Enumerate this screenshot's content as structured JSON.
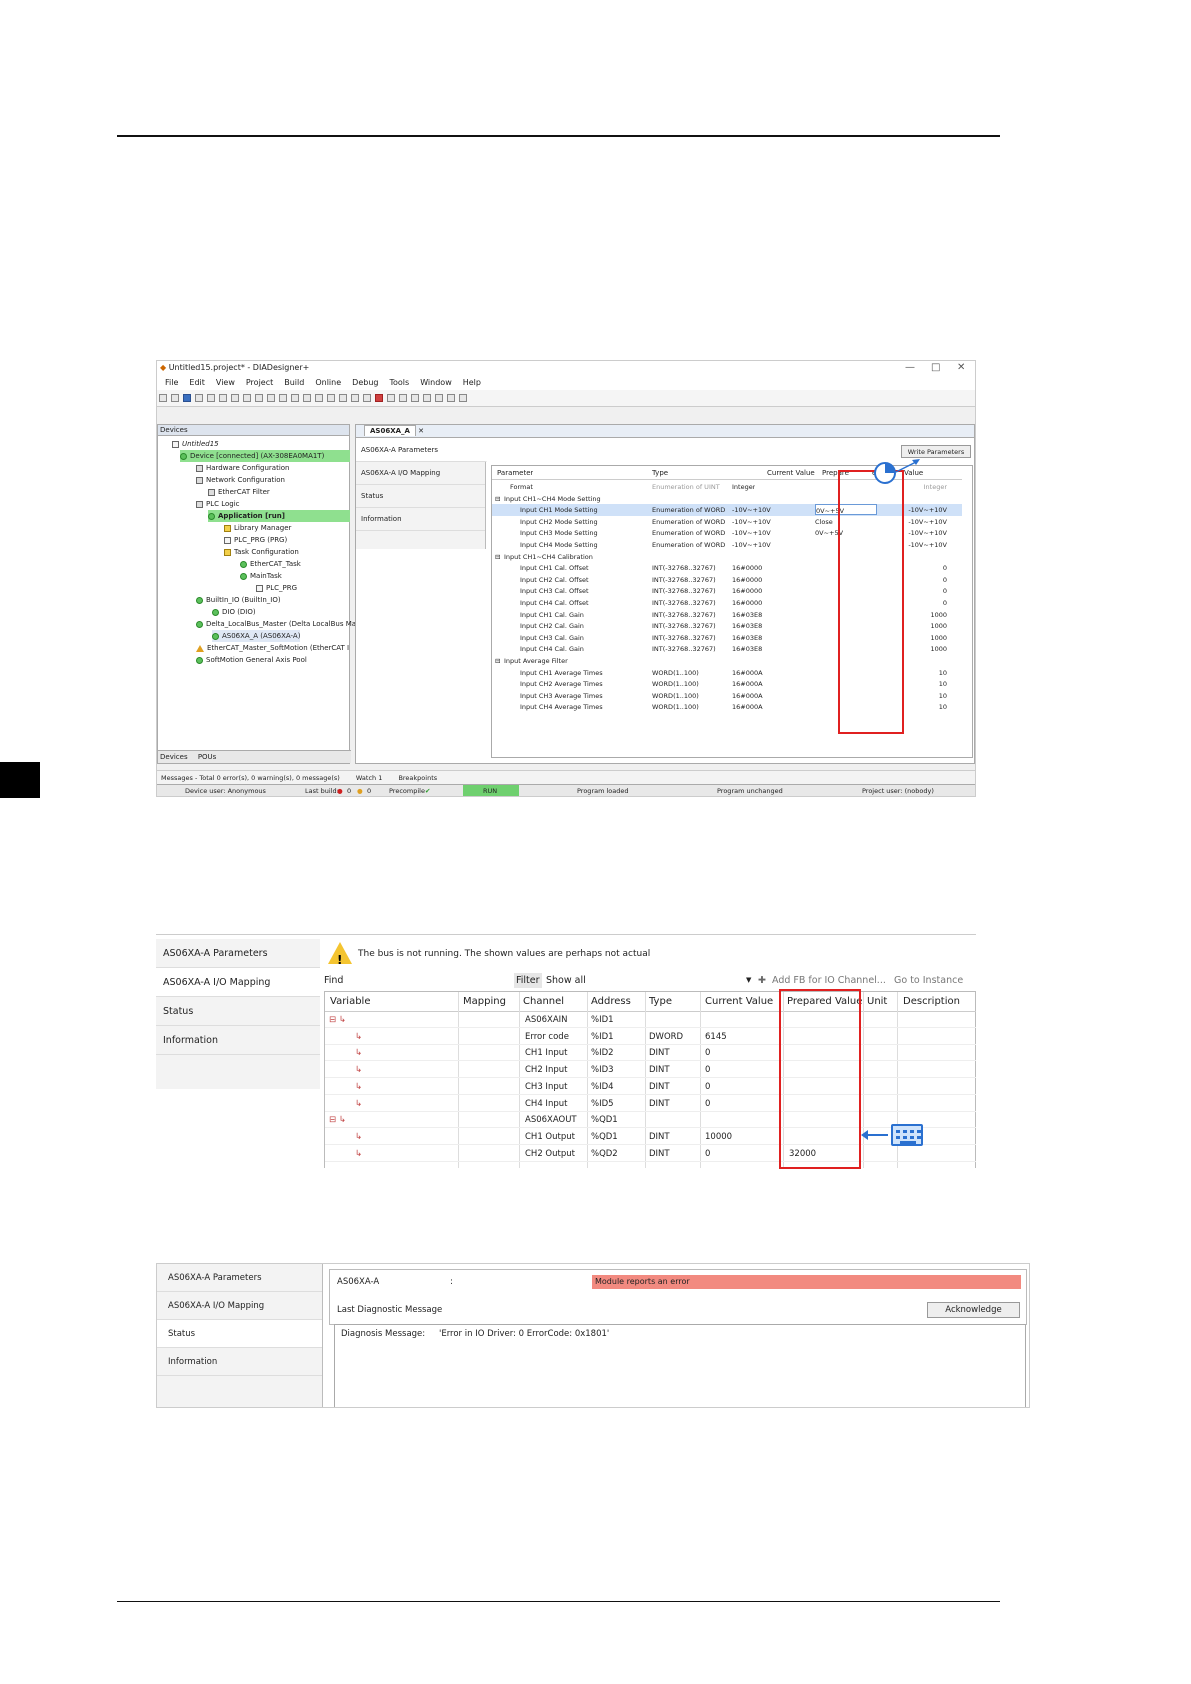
{
  "ss1": {
    "title": "Untitled15.project* - DIADesigner+",
    "window_controls": [
      "—",
      "□",
      "✕"
    ],
    "menu": [
      "File",
      "Edit",
      "View",
      "Project",
      "Build",
      "Online",
      "Debug",
      "Tools",
      "Window",
      "Help"
    ],
    "devices_panel": {
      "title": "Devices",
      "tree": [
        "Untitled15",
        "Device [connected] (AX-308EA0MA1T)",
        "Hardware Configuration",
        "Network Configuration",
        "EtherCAT Filter",
        "PLC Logic",
        "Application [run]",
        "Library Manager",
        "PLC_PRG (PRG)",
        "Task Configuration",
        "EtherCAT_Task",
        "MainTask",
        "PLC_PRG",
        "BuiltIn_IO (BuiltIn_IO)",
        "DIO (DIO)",
        "Delta_LocalBus_Master (Delta LocalBus Ma",
        "AS06XA_A (AS06XA-A)",
        "EtherCAT_Master_SoftMotion (EtherCAT I",
        "SoftMotion General Axis Pool"
      ],
      "tabs": [
        "Devices",
        "POUs"
      ]
    },
    "editor": {
      "tab": "AS06XA_A",
      "nav": [
        "AS06XA-A Parameters",
        "AS06XA-A I/O Mapping",
        "Status",
        "Information"
      ],
      "panel_title": "AS06XA-A Parameters",
      "write_button": "Write Parameters",
      "headers": [
        "Parameter",
        "Type",
        "Current Value",
        "Prepare",
        "e",
        "Value"
      ],
      "rows": [
        {
          "p": "Format",
          "t": "Enumeration of UINT",
          "c": "Integer",
          "pr": "",
          "v": "Integer",
          "grey": true
        },
        {
          "p": "Input CH1~CH4 Mode Setting",
          "t": "",
          "c": "",
          "pr": "",
          "v": ""
        },
        {
          "p": "Input CH1 Mode Setting",
          "t": "Enumeration of WORD",
          "c": "-10V~+10V",
          "pr": "0V~+5V",
          "v": "-10V~+10V"
        },
        {
          "p": "Input CH2 Mode Setting",
          "t": "Enumeration of WORD",
          "c": "-10V~+10V",
          "pr": "Close",
          "v": "-10V~+10V"
        },
        {
          "p": "Input CH3 Mode Setting",
          "t": "Enumeration of WORD",
          "c": "-10V~+10V",
          "pr": "0V~+5V",
          "v": "-10V~+10V"
        },
        {
          "p": "Input CH4 Mode Setting",
          "t": "Enumeration of WORD",
          "c": "-10V~+10V",
          "pr": "",
          "v": "-10V~+10V"
        },
        {
          "p": "Input CH1~CH4 Calibration",
          "t": "",
          "c": "",
          "pr": "",
          "v": ""
        },
        {
          "p": "Input CH1 Cal. Offset",
          "t": "INT(-32768..32767)",
          "c": "16#0000",
          "pr": "",
          "v": "0"
        },
        {
          "p": "Input CH2 Cal. Offset",
          "t": "INT(-32768..32767)",
          "c": "16#0000",
          "pr": "",
          "v": "0"
        },
        {
          "p": "Input CH3 Cal. Offset",
          "t": "INT(-32768..32767)",
          "c": "16#0000",
          "pr": "",
          "v": "0"
        },
        {
          "p": "Input CH4 Cal. Offset",
          "t": "INT(-32768..32767)",
          "c": "16#0000",
          "pr": "",
          "v": "0"
        },
        {
          "p": "Input CH1 Cal. Gain",
          "t": "INT(-32768..32767)",
          "c": "16#03E8",
          "pr": "",
          "v": "1000"
        },
        {
          "p": "Input CH2 Cal. Gain",
          "t": "INT(-32768..32767)",
          "c": "16#03E8",
          "pr": "",
          "v": "1000"
        },
        {
          "p": "Input CH3 Cal. Gain",
          "t": "INT(-32768..32767)",
          "c": "16#03E8",
          "pr": "",
          "v": "1000"
        },
        {
          "p": "Input CH4 Cal. Gain",
          "t": "INT(-32768..32767)",
          "c": "16#03E8",
          "pr": "",
          "v": "1000"
        },
        {
          "p": "Input Average Filter",
          "t": "",
          "c": "",
          "pr": "",
          "v": ""
        },
        {
          "p": "Input CH1 Average Times",
          "t": "WORD(1..100)",
          "c": "16#000A",
          "pr": "",
          "v": "10"
        },
        {
          "p": "Input CH2 Average Times",
          "t": "WORD(1..100)",
          "c": "16#000A",
          "pr": "",
          "v": "10"
        },
        {
          "p": "Input CH3 Average Times",
          "t": "WORD(1..100)",
          "c": "16#000A",
          "pr": "",
          "v": "10"
        },
        {
          "p": "Input CH4 Average Times",
          "t": "WORD(1..100)",
          "c": "16#000A",
          "pr": "",
          "v": "10"
        }
      ]
    },
    "messages": "Messages - Total 0 error(s), 0 warning(s), 0 message(s)",
    "watch": "Watch 1",
    "breakpoints": "Breakpoints",
    "status": {
      "device_user": "Device user: Anonymous",
      "last_build": "Last build:",
      "err": "0",
      "warn": "0",
      "precompile": "Precompile",
      "run": "RUN",
      "program_loaded": "Program loaded",
      "program_unchanged": "Program unchanged",
      "project_user": "Project user: (nobody)"
    }
  },
  "ss2": {
    "nav": [
      "AS06XA-A Parameters",
      "AS06XA-A I/O Mapping",
      "Status",
      "Information"
    ],
    "warning": "The bus is not running. The shown values are perhaps not actual",
    "find": "Find",
    "filter": "Filter",
    "show_all": "Show all",
    "add_fb": "Add FB for IO Channel...",
    "go_to_instance": "Go to Instance",
    "headers": [
      "Variable",
      "Mapping",
      "Channel",
      "Address",
      "Type",
      "Current Value",
      "Prepared Value",
      "Unit",
      "Description"
    ],
    "rows": [
      {
        "ch": "AS06XAIN",
        "addr": "%ID1",
        "type": "",
        "cur": "",
        "prep": "",
        "group": true
      },
      {
        "ch": "Error code",
        "addr": "%ID1",
        "type": "DWORD",
        "cur": "6145",
        "prep": ""
      },
      {
        "ch": "CH1 Input",
        "addr": "%ID2",
        "type": "DINT",
        "cur": "0",
        "prep": ""
      },
      {
        "ch": "CH2 Input",
        "addr": "%ID3",
        "type": "DINT",
        "cur": "0",
        "prep": ""
      },
      {
        "ch": "CH3 Input",
        "addr": "%ID4",
        "type": "DINT",
        "cur": "0",
        "prep": ""
      },
      {
        "ch": "CH4 Input",
        "addr": "%ID5",
        "type": "DINT",
        "cur": "0",
        "prep": ""
      },
      {
        "ch": "AS06XAOUT",
        "addr": "%QD1",
        "type": "",
        "cur": "",
        "prep": "",
        "group": true
      },
      {
        "ch": "CH1 Output",
        "addr": "%QD1",
        "type": "DINT",
        "cur": "10000",
        "prep": ""
      },
      {
        "ch": "CH2 Output",
        "addr": "%QD2",
        "type": "DINT",
        "cur": "0",
        "prep": "32000"
      }
    ]
  },
  "ss3": {
    "nav": [
      "AS06XA-A Parameters",
      "AS06XA-A I/O Mapping",
      "Status",
      "Information"
    ],
    "module": "AS06XA-A",
    "colon": ":",
    "error": "Module reports an error",
    "last_diag": "Last Diagnostic Message",
    "ack": "Acknowledge",
    "diag_label": "Diagnosis Message:",
    "diag_msg": "'Error in IO Driver: 0 ErrorCode: 0x1801'"
  },
  "colors": {
    "highlight_green": "#8fe08f",
    "red_box": "#e02020",
    "error_bar": "#f28a80",
    "accent_blue": "#2a70d0"
  }
}
